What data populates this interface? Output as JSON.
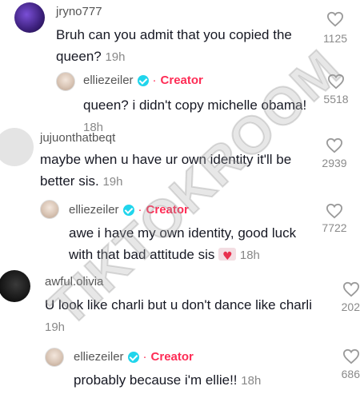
{
  "comments": [
    {
      "username": "jryno777",
      "text": "Bruh can you admit that you copied the queen?",
      "time": "19h",
      "likes": "1125",
      "reply": {
        "username": "elliezeiler",
        "dot": "·",
        "badge": "Creator",
        "text": "queen? i didn't copy michelle obama!",
        "time": "18h",
        "likes": "5518"
      }
    },
    {
      "username": "jujuonthatbeqt",
      "text": "maybe when u have ur own identity it'll be better sis.",
      "time": "19h",
      "likes": "2939",
      "reply": {
        "username": "elliezeiler",
        "dot": "·",
        "badge": "Creator",
        "text": "awe i have my own identity, good luck with that bad attitude sis",
        "time": "18h",
        "likes": "7722"
      }
    },
    {
      "username": "awful.olivia",
      "text": "U look like charli but u don't dance like charli",
      "time": "19h",
      "likes": "202",
      "reply": {
        "username": "elliezeiler",
        "dot": "·",
        "badge": "Creator",
        "text": "probably because i'm ellie!!",
        "time": "18h",
        "likes": "686"
      }
    }
  ],
  "watermark": "TIKTOKROOM",
  "colors": {
    "accent": "#fe2c55",
    "verified": "#20d5ec",
    "text": "#161823",
    "muted": "#888888"
  }
}
